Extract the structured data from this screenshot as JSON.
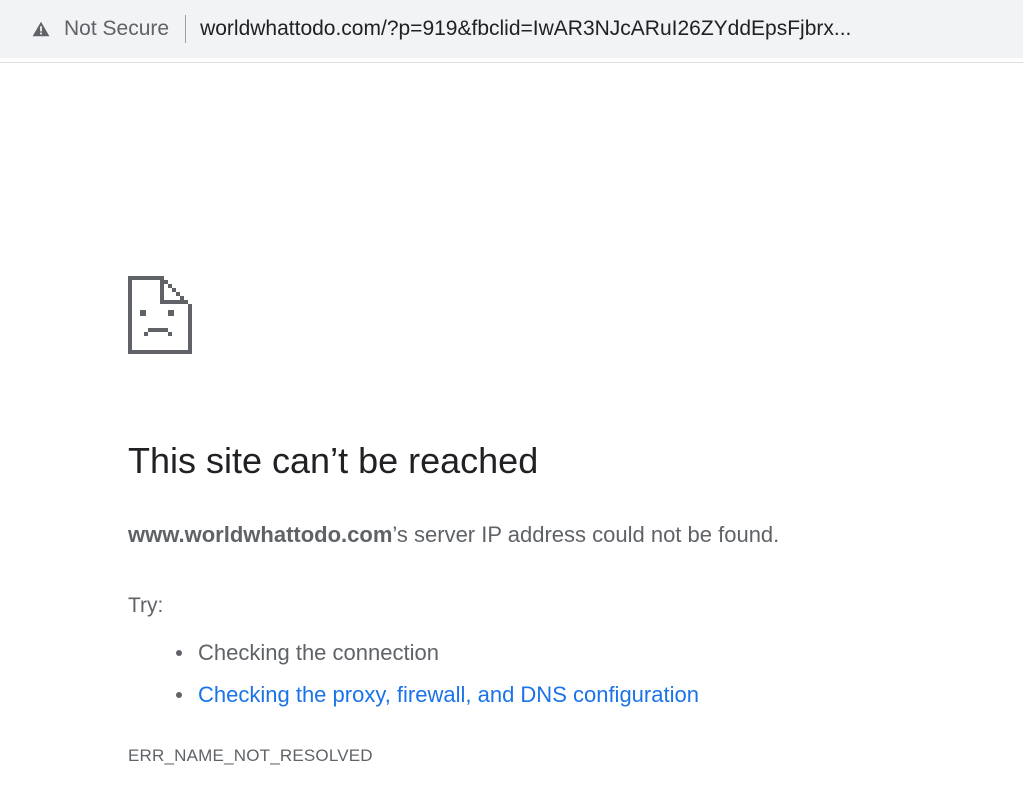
{
  "omnibox": {
    "security_label": "Not Secure",
    "url": "worldwhattodo.com/?p=919&fbclid=IwAR3NJcARuI26ZYddEpsFjbrx..."
  },
  "error_page": {
    "icon": "sad-document-icon",
    "title": "This site can’t be reached",
    "host": "www.worldwhattodo.com",
    "description_suffix": "’s server IP address could not be found.",
    "try_label": "Try:",
    "suggestions": [
      {
        "label": "Checking the connection",
        "link": false
      },
      {
        "label": "Checking the proxy, firewall, and DNS configuration",
        "link": true
      }
    ],
    "error_code": "ERR_NAME_NOT_RESOLVED"
  },
  "colors": {
    "link": "#1a73e8",
    "text_primary": "#202124",
    "text_secondary": "#5f6368",
    "omnibox_bg": "#f1f3f4"
  }
}
